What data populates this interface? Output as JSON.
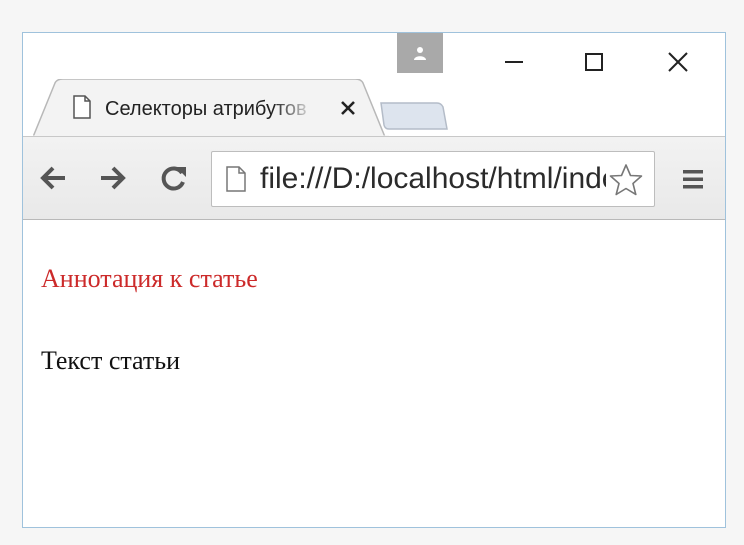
{
  "browser": {
    "tab": {
      "title": "Селекторы атрибутов",
      "close_label": "✕"
    },
    "window_controls": {
      "minimize": "minimize",
      "maximize": "maximize",
      "close": "close"
    },
    "toolbar": {
      "url": "file:///D:/localhost/html/index.html"
    }
  },
  "page": {
    "annotation_text": "Аннотация к статье",
    "annotation_color": "#cc2a2a",
    "body_text": "Текст статьи"
  },
  "icons": {
    "profile": "profile-icon",
    "back": "back-arrow-icon",
    "forward": "forward-arrow-icon",
    "reload": "reload-icon",
    "page": "page-icon",
    "star": "star-icon",
    "menu": "menu-icon"
  }
}
